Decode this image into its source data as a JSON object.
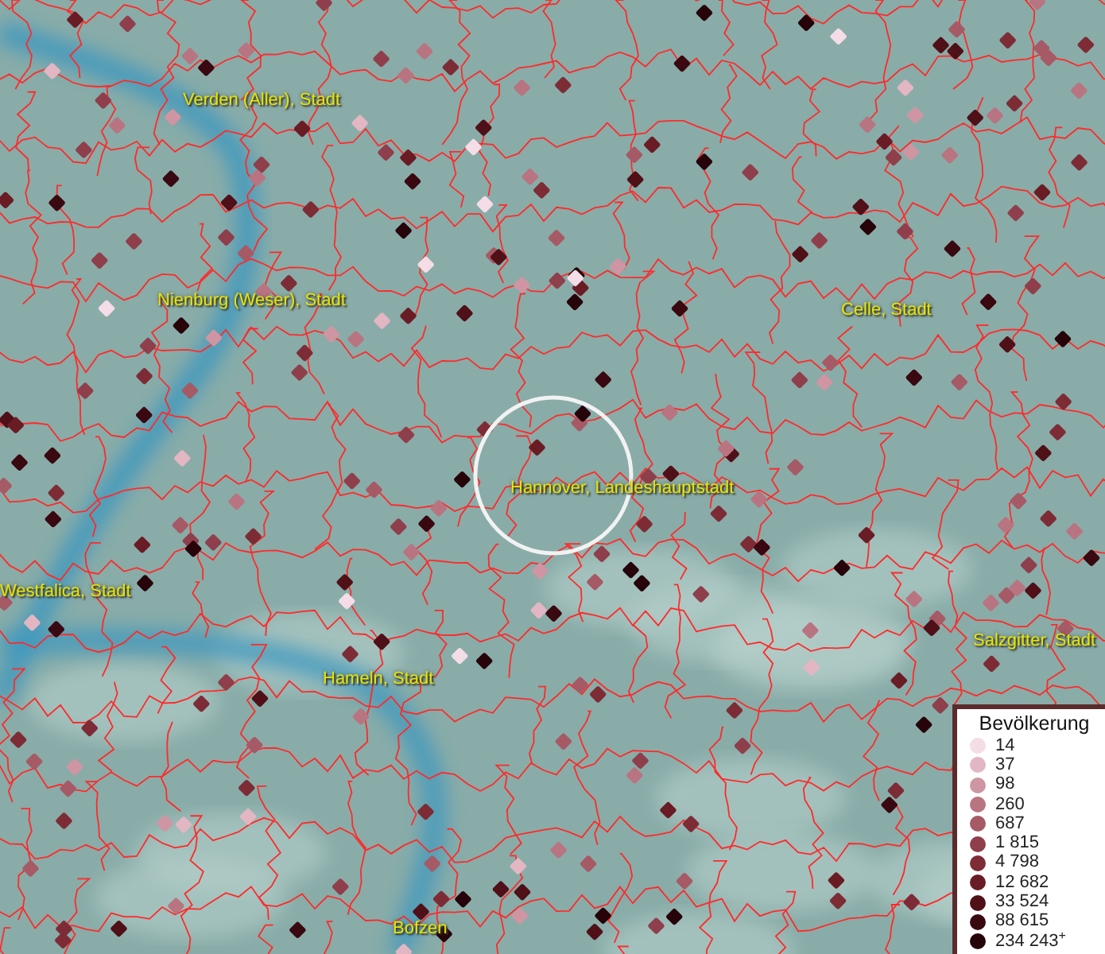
{
  "map": {
    "labels": [
      {
        "text": "Verden (Aller), Stadt"
      },
      {
        "text": "Nienburg (Weser), Stadt"
      },
      {
        "text": "Celle, Stadt"
      },
      {
        "text": "Hannover, Landeshauptstadt"
      },
      {
        "text": "Westfalica, Stadt"
      },
      {
        "text": "Salzgitter, Stadt"
      },
      {
        "text": "Hameln, Stadt"
      },
      {
        "text": "Bofzen"
      }
    ]
  },
  "legend": {
    "title": "Bevölkerung",
    "items": [
      {
        "label": "14",
        "color": "#f4dde6"
      },
      {
        "label": "37",
        "color": "#e2b6c2"
      },
      {
        "label": "98",
        "color": "#cf95a3"
      },
      {
        "label": "260",
        "color": "#b97481"
      },
      {
        "label": "687",
        "color": "#a65a66"
      },
      {
        "label": "1 815",
        "color": "#8f3f4b"
      },
      {
        "label": "4 798",
        "color": "#7d2c36"
      },
      {
        "label": "12 682",
        "color": "#6a1c25"
      },
      {
        "label": "33 524",
        "color": "#501018"
      },
      {
        "label": "88 615",
        "color": "#3a0810"
      },
      {
        "label": "234 243$^{+}$",
        "color": "#26040a"
      }
    ]
  }
}
